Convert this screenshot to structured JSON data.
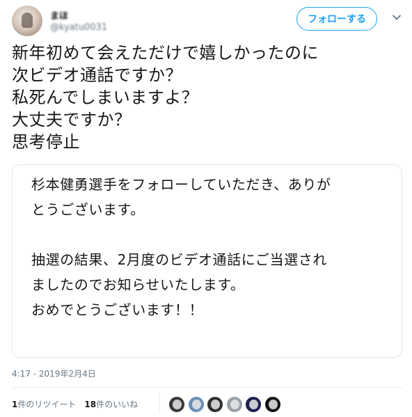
{
  "header": {
    "display_name": "まほ",
    "handle": "@kyatu0031",
    "follow_label": "フォローする"
  },
  "tweet": {
    "lines": [
      "新年初めて会えただけで嬉しかったのに",
      "次ビデオ通話ですか？",
      "私死んでしまいますよ？",
      "大丈夫ですか？",
      "思考停止"
    ]
  },
  "card": {
    "lines": [
      "杉本健勇選手をフォローしていただき、ありが",
      "とうございます。",
      "",
      "抽選の結果、2月度のビデオ通話にご当選され",
      "ましたのでお知らせいたします。",
      "おめでとうございます！！"
    ]
  },
  "timestamp": "4:17 - 2019年2月4日",
  "stats": {
    "retweets_count": "1",
    "retweets_label": "件のリツイート",
    "likes_count": "18",
    "likes_label": "件のいいね"
  },
  "icons": {
    "caret": "chevron-down-icon",
    "avatar": "avatar",
    "liker_avatars": [
      "liker-avatar",
      "liker-avatar",
      "liker-avatar",
      "liker-avatar",
      "liker-avatar",
      "liker-avatar"
    ]
  },
  "colors": {
    "accent": "#1da1f2",
    "text": "#14171a",
    "secondary": "#657786",
    "border": "#e1e8ed"
  }
}
